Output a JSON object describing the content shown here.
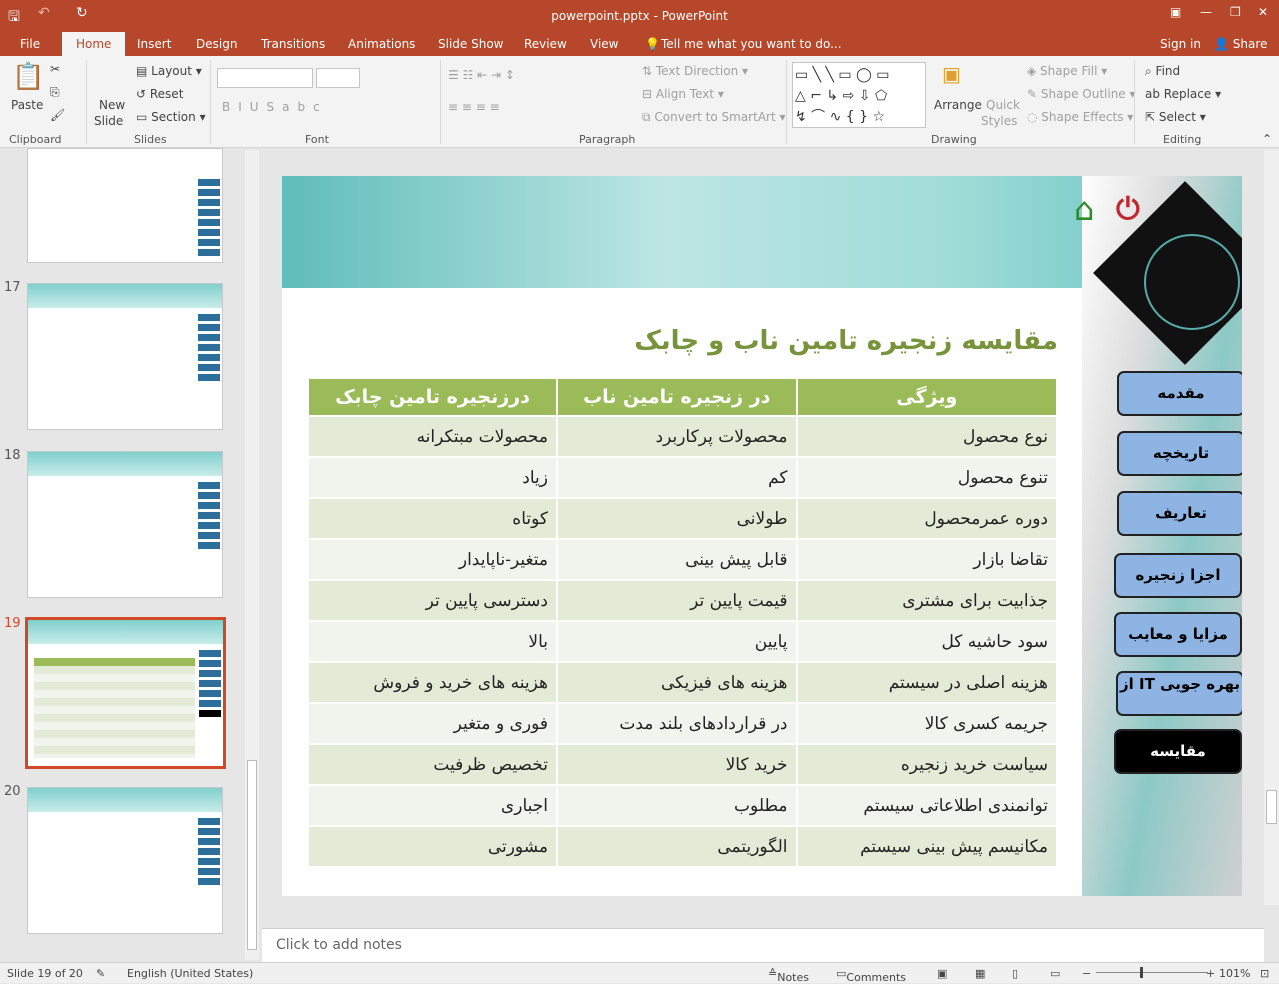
{
  "window": {
    "title": "powerpoint.pptx - PowerPoint"
  },
  "tabs": [
    {
      "label": "File"
    },
    {
      "label": "Home"
    },
    {
      "label": "Insert"
    },
    {
      "label": "Design"
    },
    {
      "label": "Transitions"
    },
    {
      "label": "Animations"
    },
    {
      "label": "Slide Show"
    },
    {
      "label": "Review"
    },
    {
      "label": "View"
    }
  ],
  "tell_me": "Tell me what you want to do...",
  "account": {
    "sign_in": "Sign in",
    "share": "Share"
  },
  "ribbon": {
    "clipboard": {
      "paste": "Paste",
      "label": "Clipboard"
    },
    "slides": {
      "new_slide": "New",
      "new_slide2": "Slide",
      "layout": "Layout",
      "reset": "Reset",
      "section": "Section",
      "label": "Slides"
    },
    "font": {
      "label": "Font"
    },
    "paragraph": {
      "text_direction": "Text Direction",
      "align_text": "Align Text",
      "smartart": "Convert to SmartArt",
      "label": "Paragraph"
    },
    "drawing": {
      "arrange": "Arrange",
      "quick_styles": "Quick",
      "quick_styles2": "Styles",
      "shape_fill": "Shape Fill",
      "shape_outline": "Shape Outline",
      "shape_effects": "Shape Effects",
      "label": "Drawing"
    },
    "editing": {
      "find": "Find",
      "replace": "Replace",
      "select": "Select",
      "label": "Editing"
    }
  },
  "thumbnails": [
    {
      "num": "17"
    },
    {
      "num": "18"
    },
    {
      "num": "19"
    },
    {
      "num": "20"
    }
  ],
  "slide": {
    "title": "مقایسه زنجیره تامین ناب و چابک",
    "headers": [
      "ویژگی",
      "در زنجیره تامین ناب",
      "درزنجیره تامین چابک"
    ],
    "rows": [
      [
        "نوع محصول",
        "محصولات پرکاربرد",
        "محصولات مبتکرانه"
      ],
      [
        "تنوع محصول",
        "کم",
        "زیاد"
      ],
      [
        "دوره عمرمحصول",
        "طولانی",
        "کوتاه"
      ],
      [
        "تقاضا بازار",
        "قابل پیش بینی",
        "متغیر-ناپایدار"
      ],
      [
        "جذابیت برای مشتری",
        "قیمت پایین تر",
        "دسترسی پایین تر"
      ],
      [
        "سود حاشیه کل",
        "پایین",
        "بالا"
      ],
      [
        "هزینه اصلی در سیستم",
        "هزینه های فیزیکی",
        "هزینه های خرید و فروش"
      ],
      [
        "جریمه کسری کالا",
        "در قراردادهای بلند مدت",
        "فوری و متغیر"
      ],
      [
        "سیاست خرید زنجیره",
        "خرید کالا",
        "تخصیص ظرفیت"
      ],
      [
        "توانمندی اطلاعاتی سیستم",
        "مطلوب",
        "اجباری"
      ],
      [
        "مکانیسم پیش بینی سیستم",
        "الگوریتمی",
        "مشورتی"
      ]
    ],
    "nav": [
      "مقدمه",
      "تاریخچه",
      "تعاریف",
      "اجزا زنجیره",
      "مزایا و معایب",
      "بهره جویی IT از",
      "مقایسه"
    ]
  },
  "notes_placeholder": "Click to add notes",
  "status": {
    "slide": "Slide 19 of 20",
    "language": "English (United States)",
    "notes": "Notes",
    "comments": "Comments",
    "zoom": "101%"
  },
  "colors": {
    "accent": "#b7472a",
    "table_header": "#9bbb59",
    "title": "#77933c",
    "nav_button": "#8eb4e3"
  }
}
